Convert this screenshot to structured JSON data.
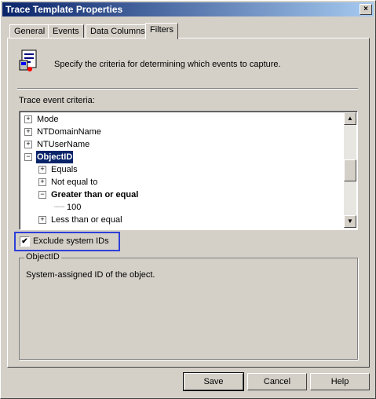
{
  "window": {
    "title": "Trace Template Properties",
    "close_glyph": "×"
  },
  "tabs": [
    {
      "label": "General"
    },
    {
      "label": "Events"
    },
    {
      "label": "Data Columns"
    },
    {
      "label": "Filters"
    }
  ],
  "info": {
    "text": "Specify the criteria for determining which events to capture."
  },
  "criteria": {
    "label": "Trace event criteria:"
  },
  "tree": {
    "items": [
      {
        "label": "Mode",
        "expander": "+"
      },
      {
        "label": "NTDomainName",
        "expander": "+"
      },
      {
        "label": "NTUserName",
        "expander": "+"
      },
      {
        "label": "ObjectID",
        "expander": "−"
      },
      {
        "label": "Equals",
        "expander": "+"
      },
      {
        "label": "Not equal to",
        "expander": "+"
      },
      {
        "label": "Greater than or equal",
        "expander": "−"
      },
      {
        "label": "100"
      },
      {
        "label": "Less than or equal",
        "expander": "+"
      }
    ]
  },
  "checkbox": {
    "label": "Exclude system IDs",
    "checked": true,
    "mark": "✔"
  },
  "description": {
    "title": "ObjectID",
    "text": "System-assigned ID of the object."
  },
  "buttons": {
    "save": "Save",
    "cancel": "Cancel",
    "help": "Help"
  },
  "scrollbar": {
    "up": "▲",
    "down": "▼"
  }
}
